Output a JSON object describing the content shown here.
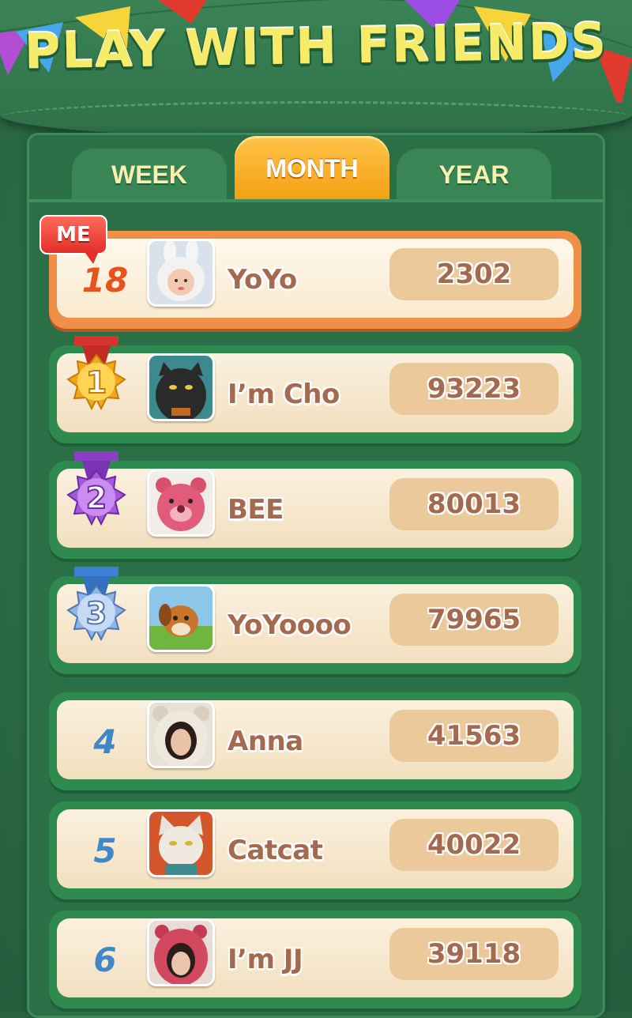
{
  "header": {
    "title": "PLAY WITH FRIENDS"
  },
  "tabs": [
    {
      "label": "WEEK",
      "active": false
    },
    {
      "label": "MONTH",
      "active": true
    },
    {
      "label": "YEAR",
      "active": false
    }
  ],
  "me_badge": "ME",
  "rows": [
    {
      "rank": "18",
      "name": "YoYo",
      "score": "2302",
      "is_me": true,
      "avatar": "girl-bunny-hat-avatar"
    },
    {
      "rank": "1",
      "name": "I’m Cho",
      "score": "93223",
      "medal": "gold",
      "avatar": "black-cat-avatar"
    },
    {
      "rank": "2",
      "name": "BEE",
      "score": "80013",
      "medal": "purple",
      "avatar": "pink-bear-avatar"
    },
    {
      "rank": "3",
      "name": "YoYoooo",
      "score": "79965",
      "medal": "blue",
      "avatar": "cartoon-dog-avatar"
    },
    {
      "rank": "4",
      "name": "Anna",
      "score": "41563",
      "avatar": "girl-bear-hood-avatar"
    },
    {
      "rank": "5",
      "name": "Catcat",
      "score": "40022",
      "avatar": "white-cat-avatar"
    },
    {
      "rank": "6",
      "name": "I’m JJ",
      "score": "39118",
      "avatar": "girl-pink-hood-avatar"
    }
  ],
  "colors": {
    "gold_medal": "#f6b21e",
    "purple_medal": "#a45ad8",
    "blue_medal": "#8fb4e8",
    "me_border": "#f09048",
    "row_border": "#2f8a4f"
  }
}
